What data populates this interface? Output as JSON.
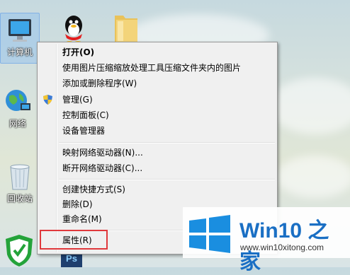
{
  "desktop": {
    "icons": [
      {
        "label": "计算机"
      },
      {
        "label": "网络"
      },
      {
        "label": "回收站"
      }
    ]
  },
  "context_menu": {
    "items": [
      {
        "label": "打开(O)"
      },
      {
        "label": "使用图片压缩缩放处理工具压缩文件夹内的图片"
      },
      {
        "label": "添加或删除程序(W)"
      },
      {
        "label": "管理(G)"
      },
      {
        "label": "控制面板(C)"
      },
      {
        "label": "设备管理器"
      },
      {
        "label": "映射网络驱动器(N)..."
      },
      {
        "label": "断开网络驱动器(C)..."
      },
      {
        "label": "创建快捷方式(S)"
      },
      {
        "label": "删除(D)"
      },
      {
        "label": "重命名(M)"
      },
      {
        "label": "属性(R)"
      }
    ]
  },
  "watermark": {
    "title": "Win10 之家",
    "url": "www.win10xitong.com"
  },
  "taskbar_partial": {
    "ps_label": "Ps"
  },
  "colors": {
    "highlight": "#e0393c",
    "brand_blue": "#1a6fc4"
  }
}
